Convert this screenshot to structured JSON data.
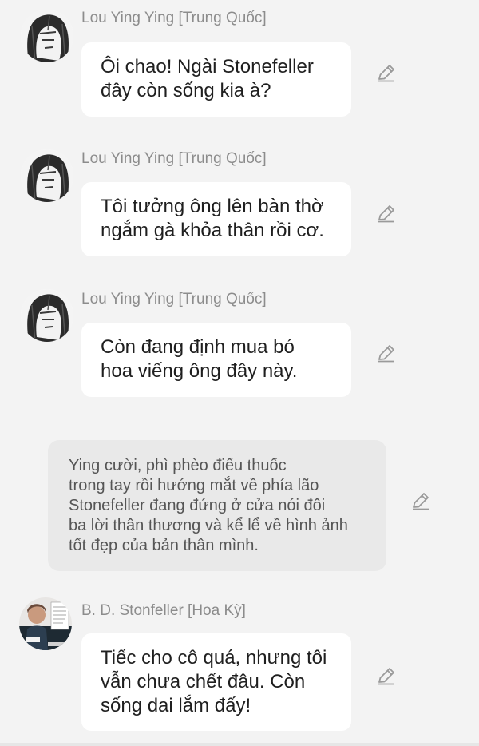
{
  "messages": [
    {
      "sender": "Lou Ying Ying [Trung Quốc]",
      "lines": [
        "Ôi chao! Ngài Stonefeller",
        "đây còn sống kia à?"
      ]
    },
    {
      "sender": "Lou Ying Ying [Trung Quốc]",
      "lines": [
        "Tôi tưởng ông lên bàn thờ",
        "ngắm gà khỏa thân rồi cơ."
      ]
    },
    {
      "sender": "Lou Ying Ying [Trung Quốc]",
      "lines": [
        "Còn đang định mua bó",
        "hoa viếng ông đây này."
      ]
    },
    {
      "sender": "B. D. Stonfeller [Hoa Kỳ]",
      "lines": [
        "Tiếc cho cô quá, nhưng tôi",
        "vẫn chưa chết đâu. Còn",
        "sống dai lắm đấy!"
      ]
    }
  ],
  "narration": {
    "lines": [
      "Ying cười, phì phèo điếu thuốc",
      "trong tay rồi hướng mắt về phía lão",
      "Stonefeller đang đứng ở cửa nói đôi",
      "ba lời thân thương và kể lể về hình ảnh",
      "tốt đẹp của bản thân mình."
    ]
  },
  "icons": {
    "edit": "pencil-edit-icon",
    "avatar_ying": "ying-avatar",
    "avatar_stonfeller": "stonfeller-avatar"
  },
  "colors": {
    "background": "#f3f3f3",
    "bubble": "#ffffff",
    "narration_bubble": "#e9e9e9",
    "sender_text": "#8c8c8c",
    "icon": "#9a9a9a"
  }
}
